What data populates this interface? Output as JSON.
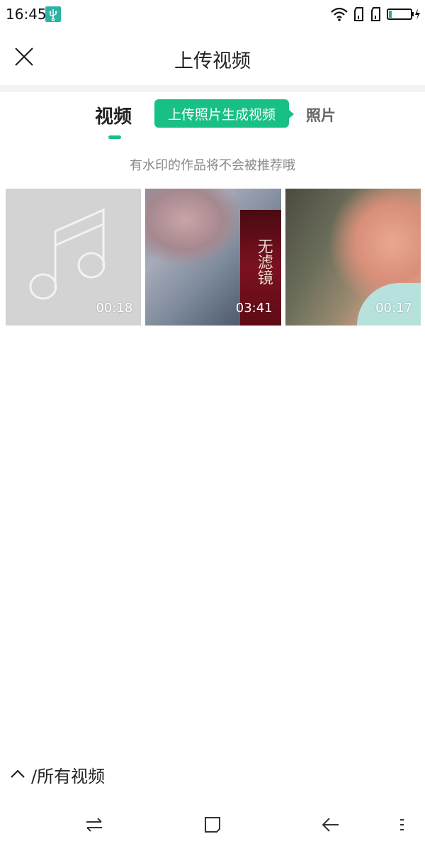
{
  "status_bar": {
    "time": "16:45",
    "icons": [
      "usb-icon",
      "wifi-icon",
      "sim-1-icon",
      "sim-2-icon",
      "battery-charging-icon"
    ]
  },
  "header": {
    "title": "上传视频",
    "close_icon": "close-icon"
  },
  "tabs": {
    "video_label": "视频",
    "promo_label": "上传照片生成视频",
    "photo_label": "照片",
    "active": "视频"
  },
  "hint": "有水印的作品将不会被推荐哦",
  "videos": [
    {
      "duration": "00:18",
      "thumbnail": "music-placeholder"
    },
    {
      "duration": "03:41",
      "thumbnail": "poster",
      "poster_text": "无滤镜"
    },
    {
      "duration": "00:17",
      "thumbnail": "photo"
    }
  ],
  "album": {
    "label": "/所有视频",
    "icon": "chevron-up-icon"
  },
  "nav_bar": {
    "icons": [
      "switch-icon",
      "home-square-icon",
      "back-arrow-icon",
      "menu-dots-icon"
    ]
  },
  "colors": {
    "accent": "#19c086",
    "thumb_placeholder": "#d3d3d3"
  }
}
